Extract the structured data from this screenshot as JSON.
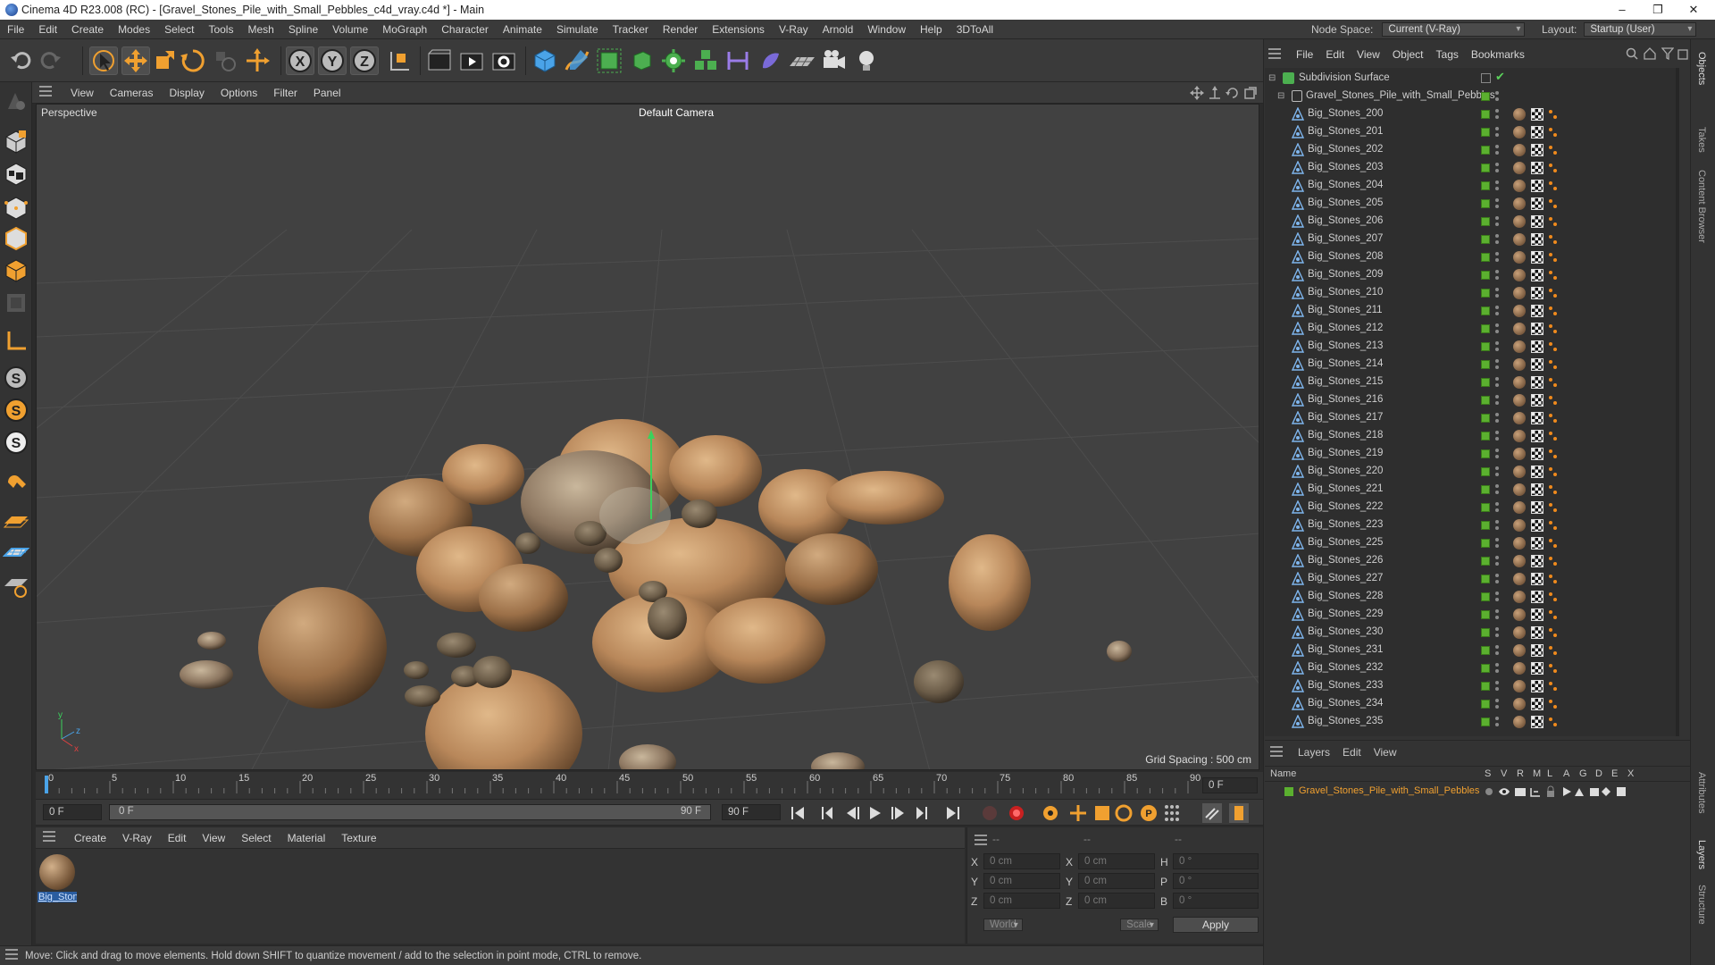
{
  "window": {
    "title": "Cinema 4D R23.008 (RC) - [Gravel_Stones_Pile_with_Small_Pebbles_c4d_vray.c4d *] - Main",
    "controls": [
      "–",
      "❐",
      "✕"
    ]
  },
  "menubar": {
    "items": [
      "File",
      "Edit",
      "Create",
      "Modes",
      "Select",
      "Tools",
      "Mesh",
      "Spline",
      "Volume",
      "MoGraph",
      "Character",
      "Animate",
      "Simulate",
      "Tracker",
      "Render",
      "Extensions",
      "V-Ray",
      "Arnold",
      "Window",
      "Help",
      "3DToAll"
    ],
    "node_space_label": "Node Space:",
    "node_space_value": "Current (V-Ray)",
    "layout_label": "Layout:",
    "layout_value": "Startup (User)"
  },
  "viewport": {
    "menu": [
      "View",
      "Cameras",
      "Display",
      "Options",
      "Filter",
      "Panel"
    ],
    "view_name": "Perspective",
    "camera": "Default Camera",
    "grid_spacing": "Grid Spacing : 500 cm"
  },
  "timeline": {
    "ticks": [
      "0",
      "5",
      "10",
      "15",
      "20",
      "25",
      "30",
      "35",
      "40",
      "45",
      "50",
      "55",
      "60",
      "65",
      "70",
      "75",
      "80",
      "85",
      "90"
    ],
    "end_frame": "0 F",
    "current_frame": "0 F",
    "range_start": "0 F",
    "range_end": "90 F",
    "max_frame": "90 F"
  },
  "material_manager": {
    "menu": [
      "Create",
      "V-Ray",
      "Edit",
      "View",
      "Select",
      "Material",
      "Texture"
    ],
    "material_name": "Big_Ston"
  },
  "coordinates": {
    "headers": [
      "--",
      "--",
      "--"
    ],
    "rows": [
      {
        "a": "X",
        "av": "0 cm",
        "b": "X",
        "bv": "0 cm",
        "c": "H",
        "cv": "0 °"
      },
      {
        "a": "Y",
        "av": "0 cm",
        "b": "Y",
        "bv": "0 cm",
        "c": "P",
        "cv": "0 °"
      },
      {
        "a": "Z",
        "av": "0 cm",
        "b": "Z",
        "bv": "0 cm",
        "c": "B",
        "cv": "0 °"
      }
    ],
    "space": "World",
    "mode": "Scale",
    "apply": "Apply"
  },
  "status": {
    "text": "Move: Click and drag to move elements. Hold down SHIFT to quantize movement / add to the selection in point mode, CTRL to remove."
  },
  "object_manager": {
    "menu": [
      "File",
      "Edit",
      "View",
      "Object",
      "Tags",
      "Bookmarks"
    ],
    "root": "Subdivision Surface",
    "group": "Gravel_Stones_Pile_with_Small_Pebbles",
    "objects": [
      "Big_Stones_200",
      "Big_Stones_201",
      "Big_Stones_202",
      "Big_Stones_203",
      "Big_Stones_204",
      "Big_Stones_205",
      "Big_Stones_206",
      "Big_Stones_207",
      "Big_Stones_208",
      "Big_Stones_209",
      "Big_Stones_210",
      "Big_Stones_211",
      "Big_Stones_212",
      "Big_Stones_213",
      "Big_Stones_214",
      "Big_Stones_215",
      "Big_Stones_216",
      "Big_Stones_217",
      "Big_Stones_218",
      "Big_Stones_219",
      "Big_Stones_220",
      "Big_Stones_221",
      "Big_Stones_222",
      "Big_Stones_223",
      "Big_Stones_225",
      "Big_Stones_226",
      "Big_Stones_227",
      "Big_Stones_228",
      "Big_Stones_229",
      "Big_Stones_230",
      "Big_Stones_231",
      "Big_Stones_232",
      "Big_Stones_233",
      "Big_Stones_234",
      "Big_Stones_235"
    ]
  },
  "layer_manager": {
    "menu": [
      "Layers",
      "Edit",
      "View"
    ],
    "name_header": "Name",
    "columns": [
      "S",
      "V",
      "R",
      "M",
      "L",
      "A",
      "G",
      "D",
      "E",
      "X"
    ],
    "layer_name": "Gravel_Stones_Pile_with_Small_Pebbles"
  },
  "side_tabs": [
    "Objects",
    "Takes",
    "Content Browser",
    "Attributes",
    "Layers",
    "Structure"
  ],
  "colors": {
    "accent_green": "#5bb02f",
    "layer_text": "#f0a030",
    "stone": "#b8875a"
  }
}
